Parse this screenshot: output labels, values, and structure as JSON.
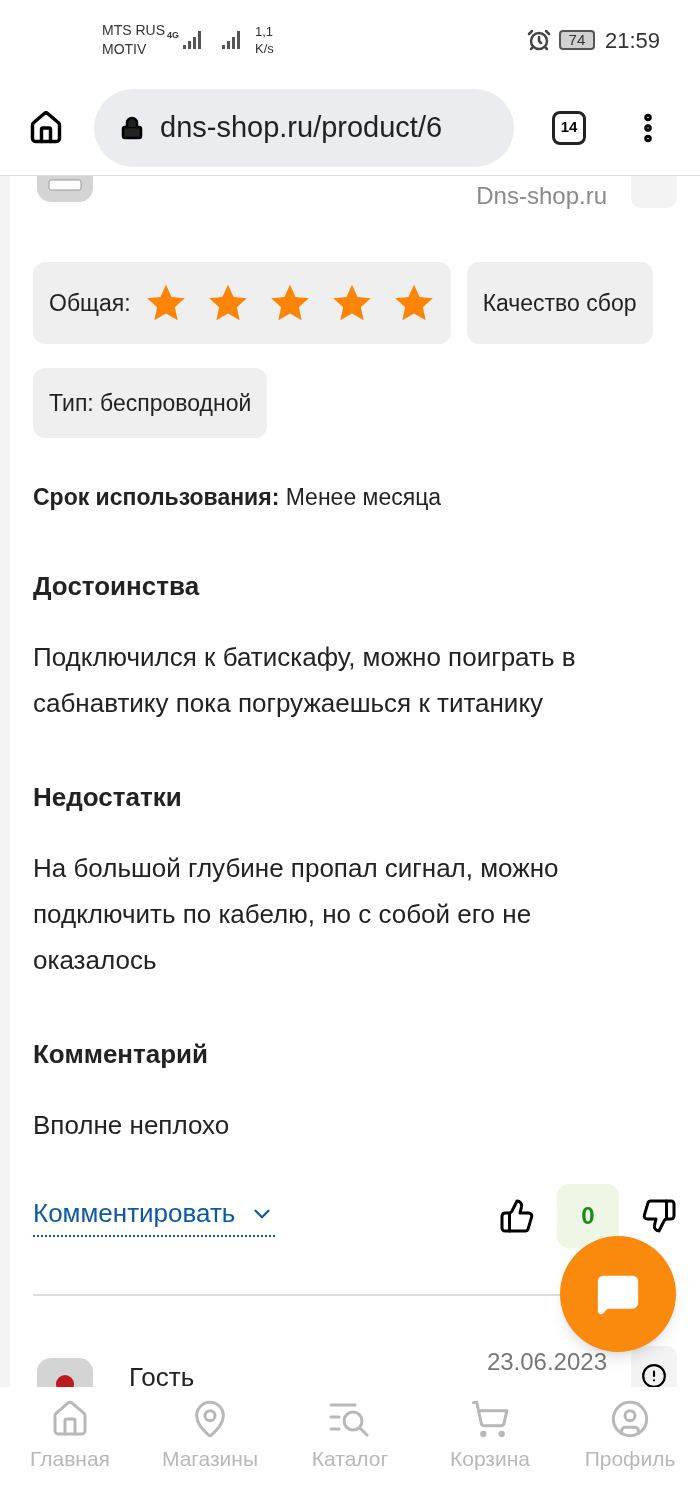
{
  "status_bar": {
    "carrier_1": "MTS RUS",
    "carrier_2": "MOTIV",
    "network": "4G",
    "speed_value": "1,1",
    "speed_unit": "K/s",
    "battery": "74",
    "time": "21:59"
  },
  "browser": {
    "url": "dns-shop.ru/product/6",
    "tab_count": "14"
  },
  "review": {
    "source": "Dns-shop.ru",
    "ratings": [
      {
        "label": "Общая:",
        "stars": 5
      },
      {
        "label": "Качество сбор"
      }
    ],
    "tags": [
      "Тип: беспроводной"
    ],
    "usage": "**Срок использования:** Менее месяца",
    "sections": [
      {
        "title": "Достоинства",
        "text": "Подключился к батискафу, можно поиграть в сабнавтику пока погружаешься к титанику"
      },
      {
        "title": "Недостатки",
        "text": "На большой глубине пропал сигнал, можно подключить по кабелю, но с собой его не оказалось"
      },
      {
        "title": "Комментарий",
        "text": "Вполне неплохо"
      }
    ],
    "comment_link": "Комментировать",
    "votes": "0"
  },
  "next_review": {
    "author": "Гость",
    "date": "23.06.2023"
  },
  "nav": [
    {
      "label": "Главная",
      "selected": false
    },
    {
      "label": "Магазины",
      "selected": false
    },
    {
      "label": "Каталог",
      "selected": false
    },
    {
      "label": "Корзина",
      "selected": false
    },
    {
      "label": "Профиль",
      "selected": false
    }
  ]
}
